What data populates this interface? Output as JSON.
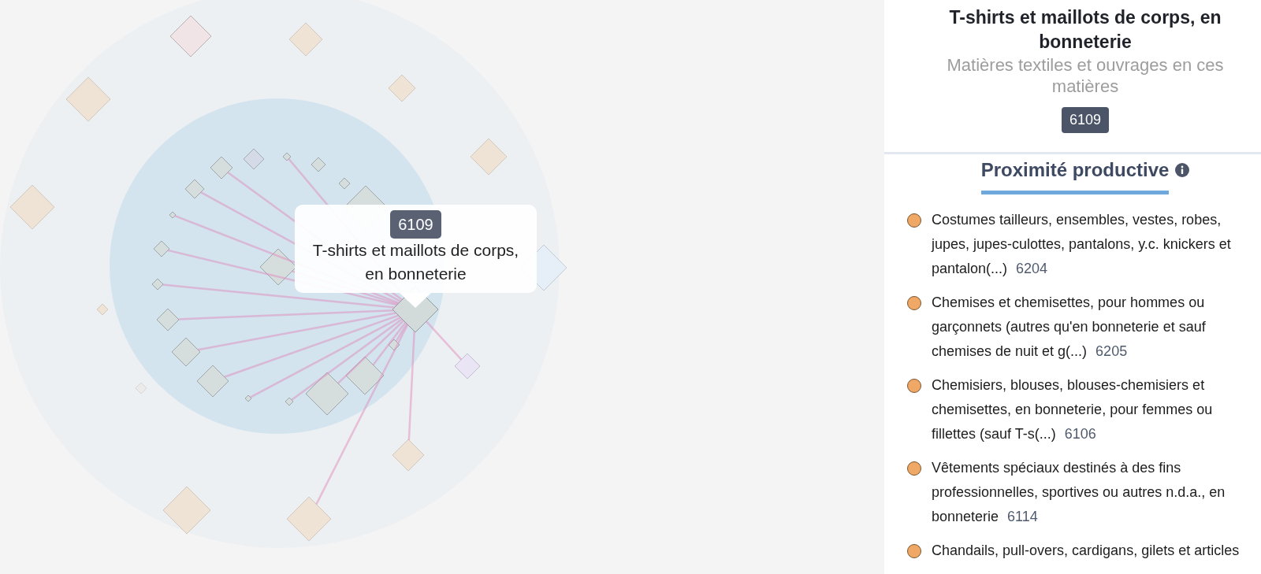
{
  "map": {
    "tooltip": {
      "code": "6109",
      "label": "T-shirts et maillots de corps, en bonneterie"
    }
  },
  "product": {
    "title": "T-shirts et maillots de corps, en bonneterie",
    "category": "Matières textiles et ouvrages en ces matières",
    "code": "6109"
  },
  "proximity": {
    "heading": "Proximité productive",
    "items": [
      {
        "name": "Costumes tailleurs, ensembles, vestes, robes, jupes, jupes-culottes, pantalons, y.c. knickers et pantalon(...)",
        "code": "6204"
      },
      {
        "name": "Chemises et chemisettes, pour hommes ou garçonnets (autres qu'en bonneterie et sauf chemises de nuit et g(...)",
        "code": "6205"
      },
      {
        "name": "Chemisiers, blouses, blouses-chemisiers et chemisettes, en bonneterie, pour femmes ou fillettes (sauf T-s(...)",
        "code": "6106"
      },
      {
        "name": "Vêtements spéciaux destinés à des fins professionnelles, sportives ou autres n.d.a., en bonneterie",
        "code": "6114"
      },
      {
        "name": "Chandails, pull-overs, cardigans, gilets et articles"
      }
    ]
  }
}
